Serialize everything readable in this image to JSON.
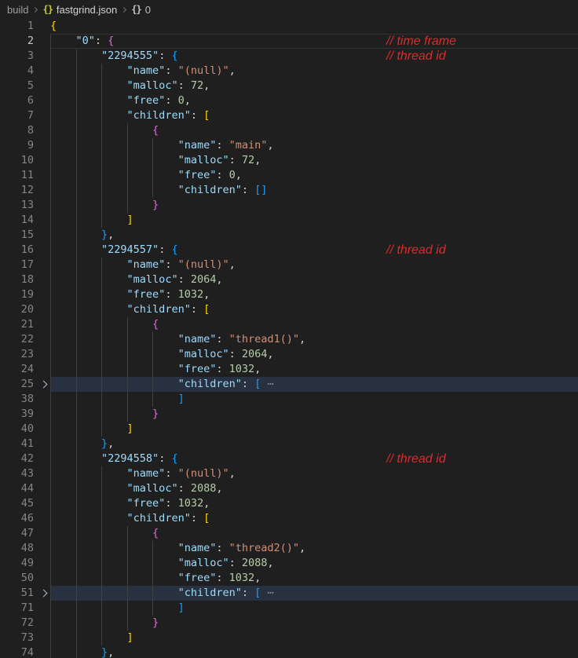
{
  "breadcrumb": {
    "items": [
      {
        "label": "build",
        "kind": "folder"
      },
      {
        "label": "fastgrind.json",
        "kind": "file",
        "icon": "json-braces-icon",
        "icon_glyph": "{}"
      },
      {
        "label": "0",
        "kind": "object-symbol",
        "icon": "object-braces-icon",
        "icon_glyph": "{}"
      }
    ]
  },
  "editor": {
    "language": "json",
    "active_line": 2,
    "folded_lines": [
      25,
      51
    ],
    "fold_ellipsis": "⋯",
    "annotations": [
      {
        "line": 2,
        "text": "// time frame"
      },
      {
        "line": 3,
        "text": "// thread id"
      },
      {
        "line": 16,
        "text": "// thread id"
      },
      {
        "line": 42,
        "text": "// thread id"
      }
    ],
    "lines": [
      {
        "n": 1,
        "i": 0,
        "t": [
          [
            "b1",
            "{"
          ]
        ]
      },
      {
        "n": 2,
        "i": 4,
        "t": [
          [
            "key",
            "\"0\""
          ],
          [
            "pun",
            ": "
          ],
          [
            "b2",
            "{"
          ]
        ],
        "active": true,
        "ann": "// time frame"
      },
      {
        "n": 3,
        "i": 8,
        "t": [
          [
            "key",
            "\"2294555\""
          ],
          [
            "pun",
            ": "
          ],
          [
            "b3",
            "{"
          ]
        ],
        "ann": "// thread id"
      },
      {
        "n": 4,
        "i": 12,
        "t": [
          [
            "key",
            "\"name\""
          ],
          [
            "pun",
            ": "
          ],
          [
            "str",
            "\"(null)\""
          ],
          [
            "pun",
            ","
          ]
        ]
      },
      {
        "n": 5,
        "i": 12,
        "t": [
          [
            "key",
            "\"malloc\""
          ],
          [
            "pun",
            ": "
          ],
          [
            "num",
            "72"
          ],
          [
            "pun",
            ","
          ]
        ]
      },
      {
        "n": 6,
        "i": 12,
        "t": [
          [
            "key",
            "\"free\""
          ],
          [
            "pun",
            ": "
          ],
          [
            "num",
            "0"
          ],
          [
            "pun",
            ","
          ]
        ]
      },
      {
        "n": 7,
        "i": 12,
        "t": [
          [
            "key",
            "\"children\""
          ],
          [
            "pun",
            ": "
          ],
          [
            "b1",
            "["
          ]
        ]
      },
      {
        "n": 8,
        "i": 16,
        "t": [
          [
            "b2",
            "{"
          ]
        ]
      },
      {
        "n": 9,
        "i": 20,
        "t": [
          [
            "key",
            "\"name\""
          ],
          [
            "pun",
            ": "
          ],
          [
            "str",
            "\"main\""
          ],
          [
            "pun",
            ","
          ]
        ]
      },
      {
        "n": 10,
        "i": 20,
        "t": [
          [
            "key",
            "\"malloc\""
          ],
          [
            "pun",
            ": "
          ],
          [
            "num",
            "72"
          ],
          [
            "pun",
            ","
          ]
        ]
      },
      {
        "n": 11,
        "i": 20,
        "t": [
          [
            "key",
            "\"free\""
          ],
          [
            "pun",
            ": "
          ],
          [
            "num",
            "0"
          ],
          [
            "pun",
            ","
          ]
        ]
      },
      {
        "n": 12,
        "i": 20,
        "t": [
          [
            "key",
            "\"children\""
          ],
          [
            "pun",
            ": "
          ],
          [
            "b3",
            "[]"
          ]
        ]
      },
      {
        "n": 13,
        "i": 16,
        "t": [
          [
            "b2",
            "}"
          ]
        ]
      },
      {
        "n": 14,
        "i": 12,
        "t": [
          [
            "b1",
            "]"
          ]
        ]
      },
      {
        "n": 15,
        "i": 8,
        "t": [
          [
            "b3",
            "}"
          ],
          [
            "pun",
            ","
          ]
        ]
      },
      {
        "n": 16,
        "i": 8,
        "t": [
          [
            "key",
            "\"2294557\""
          ],
          [
            "pun",
            ": "
          ],
          [
            "b3",
            "{"
          ]
        ],
        "ann": "// thread id"
      },
      {
        "n": 17,
        "i": 12,
        "t": [
          [
            "key",
            "\"name\""
          ],
          [
            "pun",
            ": "
          ],
          [
            "str",
            "\"(null)\""
          ],
          [
            "pun",
            ","
          ]
        ]
      },
      {
        "n": 18,
        "i": 12,
        "t": [
          [
            "key",
            "\"malloc\""
          ],
          [
            "pun",
            ": "
          ],
          [
            "num",
            "2064"
          ],
          [
            "pun",
            ","
          ]
        ]
      },
      {
        "n": 19,
        "i": 12,
        "t": [
          [
            "key",
            "\"free\""
          ],
          [
            "pun",
            ": "
          ],
          [
            "num",
            "1032"
          ],
          [
            "pun",
            ","
          ]
        ]
      },
      {
        "n": 20,
        "i": 12,
        "t": [
          [
            "key",
            "\"children\""
          ],
          [
            "pun",
            ": "
          ],
          [
            "b1",
            "["
          ]
        ]
      },
      {
        "n": 21,
        "i": 16,
        "t": [
          [
            "b2",
            "{"
          ]
        ]
      },
      {
        "n": 22,
        "i": 20,
        "t": [
          [
            "key",
            "\"name\""
          ],
          [
            "pun",
            ": "
          ],
          [
            "str",
            "\"thread1()\""
          ],
          [
            "pun",
            ","
          ]
        ]
      },
      {
        "n": 23,
        "i": 20,
        "t": [
          [
            "key",
            "\"malloc\""
          ],
          [
            "pun",
            ": "
          ],
          [
            "num",
            "2064"
          ],
          [
            "pun",
            ","
          ]
        ]
      },
      {
        "n": 24,
        "i": 20,
        "t": [
          [
            "key",
            "\"free\""
          ],
          [
            "pun",
            ": "
          ],
          [
            "num",
            "1032"
          ],
          [
            "pun",
            ","
          ]
        ]
      },
      {
        "n": 25,
        "i": 20,
        "t": [
          [
            "key",
            "\"children\""
          ],
          [
            "pun",
            ": "
          ],
          [
            "b3",
            "["
          ],
          [
            "dots",
            " ⋯"
          ]
        ],
        "folded": true
      },
      {
        "n": 38,
        "i": 20,
        "t": [
          [
            "b3",
            "]"
          ]
        ]
      },
      {
        "n": 39,
        "i": 16,
        "t": [
          [
            "b2",
            "}"
          ]
        ]
      },
      {
        "n": 40,
        "i": 12,
        "t": [
          [
            "b1",
            "]"
          ]
        ]
      },
      {
        "n": 41,
        "i": 8,
        "t": [
          [
            "b3",
            "}"
          ],
          [
            "pun",
            ","
          ]
        ]
      },
      {
        "n": 42,
        "i": 8,
        "t": [
          [
            "key",
            "\"2294558\""
          ],
          [
            "pun",
            ": "
          ],
          [
            "b3",
            "{"
          ]
        ],
        "ann": "// thread id"
      },
      {
        "n": 43,
        "i": 12,
        "t": [
          [
            "key",
            "\"name\""
          ],
          [
            "pun",
            ": "
          ],
          [
            "str",
            "\"(null)\""
          ],
          [
            "pun",
            ","
          ]
        ]
      },
      {
        "n": 44,
        "i": 12,
        "t": [
          [
            "key",
            "\"malloc\""
          ],
          [
            "pun",
            ": "
          ],
          [
            "num",
            "2088"
          ],
          [
            "pun",
            ","
          ]
        ]
      },
      {
        "n": 45,
        "i": 12,
        "t": [
          [
            "key",
            "\"free\""
          ],
          [
            "pun",
            ": "
          ],
          [
            "num",
            "1032"
          ],
          [
            "pun",
            ","
          ]
        ]
      },
      {
        "n": 46,
        "i": 12,
        "t": [
          [
            "key",
            "\"children\""
          ],
          [
            "pun",
            ": "
          ],
          [
            "b1",
            "["
          ]
        ]
      },
      {
        "n": 47,
        "i": 16,
        "t": [
          [
            "b2",
            "{"
          ]
        ]
      },
      {
        "n": 48,
        "i": 20,
        "t": [
          [
            "key",
            "\"name\""
          ],
          [
            "pun",
            ": "
          ],
          [
            "str",
            "\"thread2()\""
          ],
          [
            "pun",
            ","
          ]
        ]
      },
      {
        "n": 49,
        "i": 20,
        "t": [
          [
            "key",
            "\"malloc\""
          ],
          [
            "pun",
            ": "
          ],
          [
            "num",
            "2088"
          ],
          [
            "pun",
            ","
          ]
        ]
      },
      {
        "n": 50,
        "i": 20,
        "t": [
          [
            "key",
            "\"free\""
          ],
          [
            "pun",
            ": "
          ],
          [
            "num",
            "1032"
          ],
          [
            "pun",
            ","
          ]
        ]
      },
      {
        "n": 51,
        "i": 20,
        "t": [
          [
            "key",
            "\"children\""
          ],
          [
            "pun",
            ": "
          ],
          [
            "b3",
            "["
          ],
          [
            "dots",
            " ⋯"
          ]
        ],
        "folded": true
      },
      {
        "n": 71,
        "i": 20,
        "t": [
          [
            "b3",
            "]"
          ]
        ]
      },
      {
        "n": 72,
        "i": 16,
        "t": [
          [
            "b2",
            "}"
          ]
        ]
      },
      {
        "n": 73,
        "i": 12,
        "t": [
          [
            "b1",
            "]"
          ]
        ]
      },
      {
        "n": 74,
        "i": 8,
        "t": [
          [
            "b3",
            "}"
          ],
          [
            "pun",
            ","
          ]
        ]
      }
    ]
  },
  "colors": {
    "bg": "#1f1f1f",
    "gutterFg": "#858585",
    "gutterActiveFg": "#c6c6c6",
    "key": "#9cdcfe",
    "str": "#ce9178",
    "num": "#b5cea8",
    "pun": "#d4d4d4",
    "b1": "#ffd700",
    "b2": "#da70d6",
    "b3": "#179fff",
    "dots": "#8a8a8a",
    "foldBg": "#27313f",
    "guide": "#404040",
    "lineBorder": "#323232",
    "ann": "#d92c2c",
    "crumbFg": "#a0a0a0",
    "crumbFileFg": "#d4d4d4",
    "crumbSymFg": "#bdbdbd",
    "crumbSep": "#707070",
    "jsonIcon": "#cbcb41",
    "symIcon": "#c5c5c5",
    "foldChev": "#a7bed3"
  }
}
